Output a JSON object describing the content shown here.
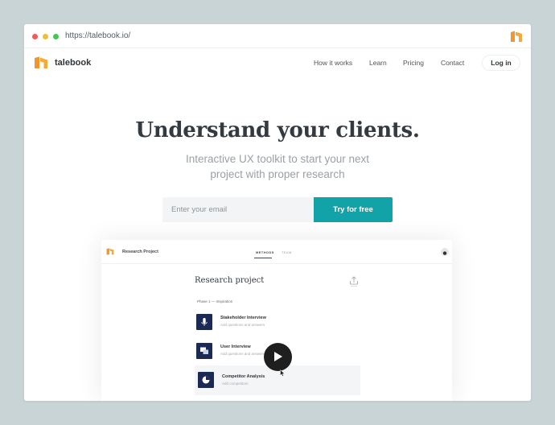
{
  "browser": {
    "url": "https://talebook.io/",
    "extension_icon": "talebook-logo-icon"
  },
  "site": {
    "brand": "talebook",
    "nav": [
      "How it works",
      "Learn",
      "Pricing",
      "Contact"
    ],
    "login_label": "Log in"
  },
  "hero": {
    "title": "Understand your clients.",
    "subtitle": "Interactive UX toolkit to start your next project with proper research",
    "email_placeholder": "Enter your email",
    "cta_label": "Try for free"
  },
  "preview": {
    "app_title": "Research Project",
    "tabs": [
      "METHODS",
      "TEAM"
    ],
    "active_tab": "METHODS",
    "heading": "Research project",
    "phase": "Phase 1 — Inspiration",
    "methods": [
      {
        "name": "Stakeholder Interview",
        "desc": "Add questions and answers",
        "icon": "microphone-icon"
      },
      {
        "name": "User Interview",
        "desc": "Add questions and answers",
        "icon": "chat-icon"
      },
      {
        "name": "Competitor Analysis",
        "desc": "Add competitors",
        "icon": "pie-chart-icon"
      }
    ]
  },
  "colors": {
    "accent": "#12a3a9",
    "logo_orange": "#f4942a",
    "method_icon_bg": "#1b2a55",
    "page_background": "#c8d4d6"
  }
}
